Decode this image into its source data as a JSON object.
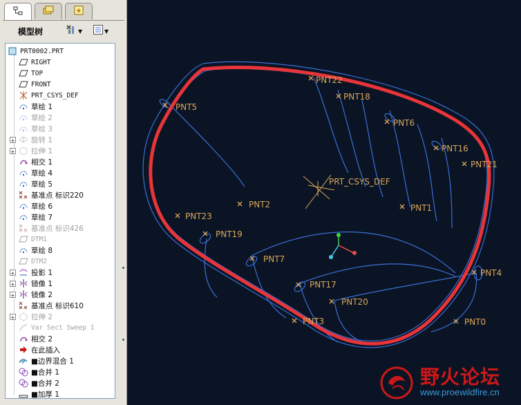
{
  "sidebar": {
    "tabs": [
      {
        "icon": "model-tree-icon",
        "active": true
      },
      {
        "icon": "folder-browser-icon",
        "active": false
      },
      {
        "icon": "favorites-icon",
        "active": false
      }
    ],
    "title": "模型树",
    "settings_icon": "tree-settings-icon",
    "columns_icon": "tree-columns-icon",
    "tree": [
      {
        "label": "PRT0002.PRT",
        "icon": "part-icon",
        "state": "normal",
        "mono": true
      },
      {
        "label": "RIGHT",
        "icon": "datum-plane-icon",
        "state": "normal",
        "mono": true
      },
      {
        "label": "TOP",
        "icon": "datum-plane-icon",
        "state": "normal",
        "mono": true
      },
      {
        "label": "FRONT",
        "icon": "datum-plane-icon",
        "state": "normal",
        "mono": true
      },
      {
        "label": "PRT_CSYS_DEF",
        "icon": "csys-icon",
        "state": "normal",
        "mono": true
      },
      {
        "label": "草绘 1",
        "icon": "sketch-icon",
        "state": "normal"
      },
      {
        "label": "草绘 2",
        "icon": "sketch-icon",
        "state": "dim"
      },
      {
        "label": "草绘 3",
        "icon": "sketch-icon",
        "state": "dim"
      },
      {
        "label": "旋转 1",
        "icon": "revolve-icon",
        "state": "dim",
        "expandable": true
      },
      {
        "label": "拉伸 1",
        "icon": "extrude-icon",
        "state": "dim",
        "expandable": true
      },
      {
        "label": "相交 1",
        "icon": "intersect-icon",
        "state": "normal"
      },
      {
        "label": "草绘 4",
        "icon": "sketch-icon",
        "state": "normal"
      },
      {
        "label": "草绘 5",
        "icon": "sketch-icon",
        "state": "normal"
      },
      {
        "label": "基准点 标识220",
        "icon": "datum-point-icon",
        "state": "normal"
      },
      {
        "label": "草绘 6",
        "icon": "sketch-icon",
        "state": "normal"
      },
      {
        "label": "草绘 7",
        "icon": "sketch-icon",
        "state": "normal"
      },
      {
        "label": "基准点 标识426",
        "icon": "datum-point-icon",
        "state": "dim"
      },
      {
        "label": "DTM1",
        "icon": "datum-plane-icon",
        "state": "dim",
        "mono": true
      },
      {
        "label": "草绘 8",
        "icon": "sketch-icon",
        "state": "normal"
      },
      {
        "label": "DTM2",
        "icon": "datum-plane-icon",
        "state": "dim",
        "mono": true
      },
      {
        "label": "投影 1",
        "icon": "projection-icon",
        "state": "normal",
        "expandable": true
      },
      {
        "label": "镜像 1",
        "icon": "mirror-icon",
        "state": "normal",
        "expandable": true
      },
      {
        "label": "镜像 2",
        "icon": "mirror-icon",
        "state": "normal",
        "expandable": true
      },
      {
        "label": "基准点 标识610",
        "icon": "datum-point-icon",
        "state": "normal"
      },
      {
        "label": "拉伸 2",
        "icon": "extrude-icon",
        "state": "dim",
        "expandable": true
      },
      {
        "label": "Var Sect Sweep 1",
        "icon": "sweep-icon",
        "state": "dim",
        "mono": true
      },
      {
        "label": "相交 2",
        "icon": "intersect-icon",
        "state": "normal"
      },
      {
        "label": "在此插入",
        "icon": "insert-here-icon",
        "state": "normal"
      },
      {
        "label": "■边界混合 1",
        "icon": "boundary-blend-icon",
        "state": "normal"
      },
      {
        "label": "■合并 1",
        "icon": "merge-icon",
        "state": "normal"
      },
      {
        "label": "■合并 2",
        "icon": "merge-icon",
        "state": "normal"
      },
      {
        "label": "■加厚 1",
        "icon": "thicken-icon",
        "state": "normal"
      }
    ]
  },
  "viewport": {
    "background": "#0b1424",
    "curve_color": "#e8353a",
    "surface_color": "#3a6fd8",
    "point_color": "#d9a75a",
    "csys_label": "PRT_CSYS_DEF",
    "points": [
      "PNT22",
      "PNT18",
      "PNT5",
      "PNT6",
      "PNT16",
      "PNT21",
      "PNT2",
      "PNT1",
      "PNT23",
      "PNT19",
      "PNT7",
      "PNT4",
      "PNT17",
      "PNT20",
      "PNT3",
      "PNT0"
    ]
  },
  "watermark": {
    "title": "野火论坛",
    "url": "www.proewildfire.cn",
    "logo_icon": "wildfire-logo-icon"
  }
}
